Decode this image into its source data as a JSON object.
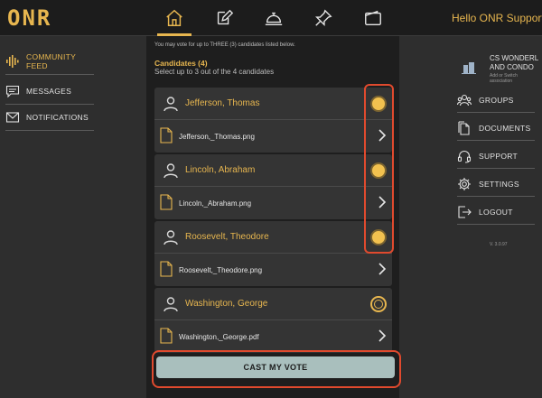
{
  "header": {
    "logo_text": "ONR",
    "greeting": "Hello ONR Support - C",
    "nav": [
      {
        "name": "home",
        "icon": "home-icon",
        "active": true
      },
      {
        "name": "document-edit",
        "icon": "pencil-document-icon",
        "active": false
      },
      {
        "name": "concierge",
        "icon": "service-bell-icon",
        "active": false
      },
      {
        "name": "pin",
        "icon": "pushpin-icon",
        "active": false
      },
      {
        "name": "wallet",
        "icon": "wallet-icon",
        "active": false
      }
    ]
  },
  "left_sidebar": {
    "items": [
      {
        "label": "COMMUNITY FEED",
        "icon": "sound-wave-icon",
        "active": true
      },
      {
        "label": "MESSAGES",
        "icon": "chat-icon",
        "active": false
      },
      {
        "label": "NOTIFICATIONS",
        "icon": "envelope-icon",
        "active": false
      }
    ]
  },
  "vote": {
    "notice": "You may vote for up to THREE (3) candidates listed below.",
    "candidates_title": "Candidates (4)",
    "candidates_subtitle": "Select up to 3 out of the 4 candidates",
    "candidates": [
      {
        "name": "Jefferson, Thomas",
        "file": "Jefferson,_Thomas.png",
        "selected": true
      },
      {
        "name": "Lincoln, Abraham",
        "file": "Lincoln,_Abraham.png",
        "selected": true
      },
      {
        "name": "Roosevelt, Theodore",
        "file": "Roosevelt,_Theodore.png",
        "selected": true
      },
      {
        "name": "Washington, George",
        "file": "Washington,_George.pdf",
        "selected": false
      }
    ],
    "cast_label": "CAST MY VOTE"
  },
  "right_sidebar": {
    "association_name": "CS WONDERL AND CONDO",
    "association_sub": "Add or Switch association",
    "items": [
      {
        "label": "GROUPS",
        "icon": "groups-icon"
      },
      {
        "label": "DOCUMENTS",
        "icon": "documents-icon"
      },
      {
        "label": "SUPPORT",
        "icon": "headset-icon"
      },
      {
        "label": "SETTINGS",
        "icon": "gear-icon"
      },
      {
        "label": "LOGOUT",
        "icon": "logout-icon"
      }
    ],
    "version": "V. 3.0.97"
  },
  "colors": {
    "accent": "#e7b64f",
    "highlight": "#e04a2e",
    "button": "#a9bfbd"
  }
}
